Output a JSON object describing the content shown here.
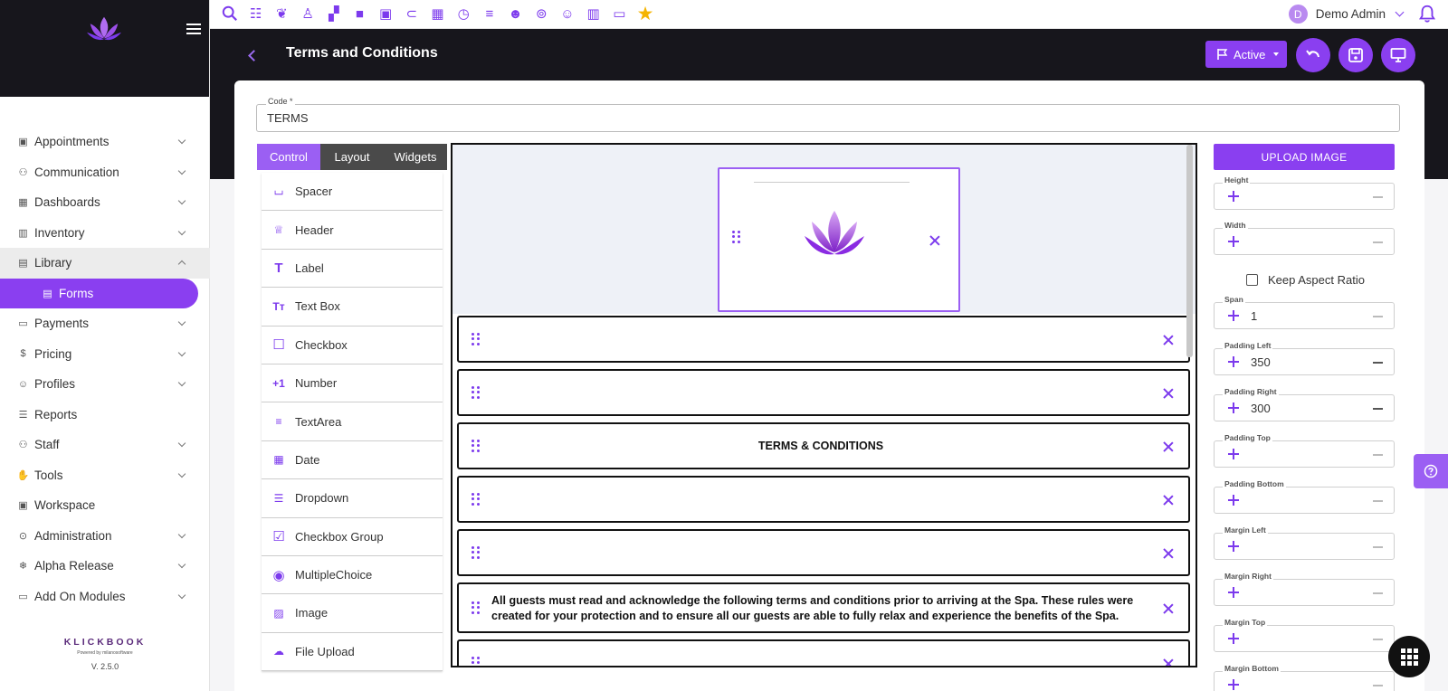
{
  "topbar": {
    "icons": [
      "search-icon",
      "sliders-icon",
      "spa-icon",
      "chair-icon",
      "apps-icon",
      "briefcase-icon",
      "dollar-bill-icon",
      "paperclip-icon",
      "calendar-icon",
      "clock-icon",
      "lines-icon",
      "face-icon",
      "alarm-icon",
      "smile-icon",
      "book-icon",
      "chat-icon",
      "star-icon"
    ],
    "user_initial": "D",
    "user_name": "Demo Admin"
  },
  "sidebar": {
    "items": [
      {
        "label": "Appointments",
        "icon": "calendar-icon",
        "chevron": "down"
      },
      {
        "label": "Communication",
        "icon": "people-icon",
        "chevron": "down"
      },
      {
        "label": "Dashboards",
        "icon": "dashboard-icon",
        "chevron": "down"
      },
      {
        "label": "Inventory",
        "icon": "chart-icon",
        "chevron": "down"
      },
      {
        "label": "Library",
        "icon": "book-icon",
        "chevron": "up",
        "active_parent": true
      },
      {
        "label": "Forms",
        "icon": "form-icon",
        "chevron": "",
        "active": true
      },
      {
        "label": "Payments",
        "icon": "card-icon",
        "chevron": "down"
      },
      {
        "label": "Pricing",
        "icon": "dollar-icon",
        "chevron": "down"
      },
      {
        "label": "Profiles",
        "icon": "person-icon",
        "chevron": "down"
      },
      {
        "label": "Reports",
        "icon": "list-icon",
        "chevron": ""
      },
      {
        "label": "Staff",
        "icon": "staff-icon",
        "chevron": "down"
      },
      {
        "label": "Tools",
        "icon": "hand-icon",
        "chevron": "down"
      },
      {
        "label": "Workspace",
        "icon": "workspace-icon",
        "chevron": ""
      },
      {
        "label": "Administration",
        "icon": "admin-icon",
        "chevron": "down"
      },
      {
        "label": "Alpha Release",
        "icon": "snowflake-icon",
        "chevron": "down"
      },
      {
        "label": "Add On Modules",
        "icon": "folder-icon",
        "chevron": "down"
      }
    ],
    "brand_name": "KLICKBOOK",
    "brand_sub": "Powered by milanosoftware",
    "version": "V. 2.5.0"
  },
  "header": {
    "title": "Terms and Conditions",
    "status_label": "Active"
  },
  "form": {
    "code_label": "Code *",
    "code_value": "TERMS"
  },
  "tabs": [
    "Control",
    "Layout",
    "Widgets"
  ],
  "controls": [
    {
      "label": "Spacer",
      "icon": "spacer-icon"
    },
    {
      "label": "Header",
      "icon": "header-icon"
    },
    {
      "label": "Label",
      "icon": "label-icon"
    },
    {
      "label": "Text Box",
      "icon": "textbox-icon"
    },
    {
      "label": "Checkbox",
      "icon": "checkbox-icon"
    },
    {
      "label": "Number",
      "icon": "number-icon"
    },
    {
      "label": "TextArea",
      "icon": "textarea-icon"
    },
    {
      "label": "Date",
      "icon": "date-icon"
    },
    {
      "label": "Dropdown",
      "icon": "dropdown-icon"
    },
    {
      "label": "Checkbox Group",
      "icon": "checkbox-group-icon"
    },
    {
      "label": "MultipleChoice",
      "icon": "radio-icon"
    },
    {
      "label": "Image",
      "icon": "image-icon"
    },
    {
      "label": "File Upload",
      "icon": "upload-icon"
    }
  ],
  "canvas": {
    "heading": "TERMS & CONDITIONS",
    "paragraph": "All guests must read and acknowledge the following terms and conditions prior to arriving at the Spa. These rules were created for your protection and to ensure all our guests are able to fully relax and experience the benefits of the Spa."
  },
  "properties": {
    "upload_label": "UPLOAD IMAGE",
    "keep_aspect_label": "Keep Aspect Ratio",
    "fields": [
      {
        "label": "Height",
        "value": ""
      },
      {
        "label": "Width",
        "value": ""
      },
      {
        "label": "Span",
        "value": "1"
      },
      {
        "label": "Padding Left",
        "value": "350"
      },
      {
        "label": "Padding Right",
        "value": "300"
      },
      {
        "label": "Padding Top",
        "value": ""
      },
      {
        "label": "Padding Bottom",
        "value": ""
      },
      {
        "label": "Margin Left",
        "value": ""
      },
      {
        "label": "Margin Right",
        "value": ""
      },
      {
        "label": "Margin Top",
        "value": ""
      },
      {
        "label": "Margin Bottom",
        "value": ""
      }
    ]
  },
  "colors": {
    "accent": "#8a3ff0",
    "dark": "#17161c"
  }
}
